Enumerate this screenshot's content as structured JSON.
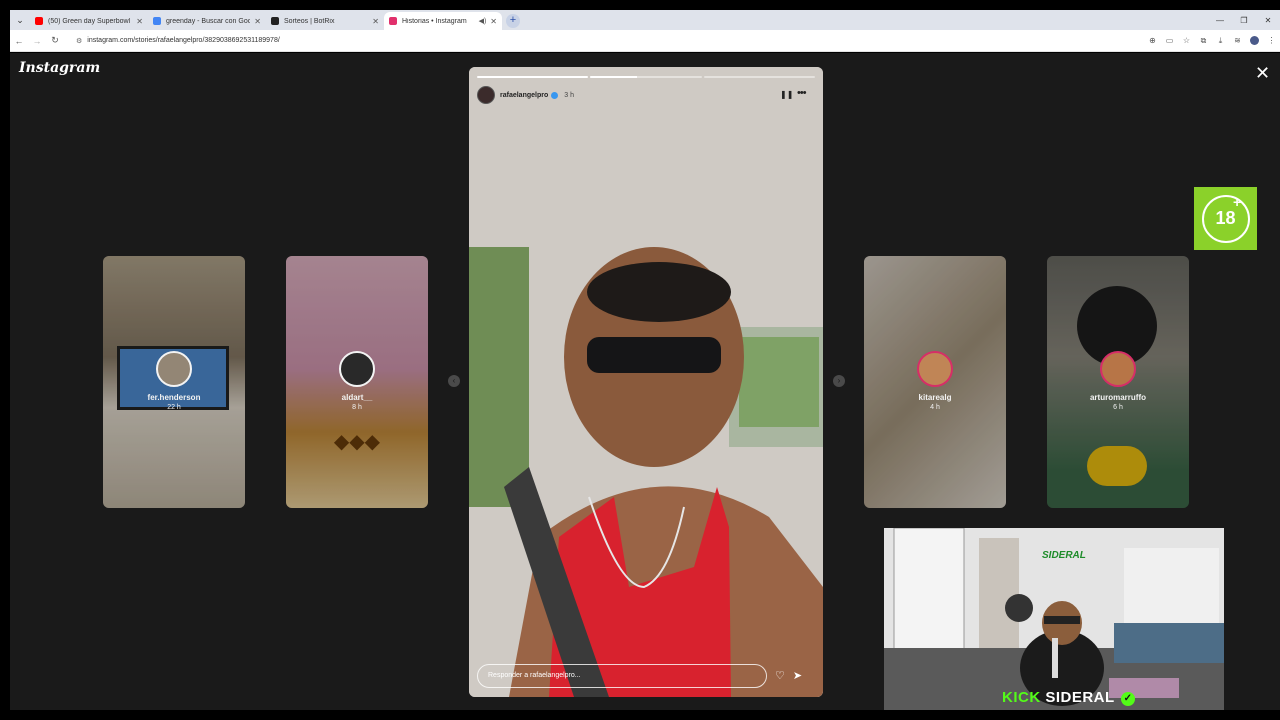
{
  "browser": {
    "tabs": [
      {
        "title": "(50) Green day Superbowl 202...",
        "favicon_color": "#ff0000",
        "icon": "youtube-icon"
      },
      {
        "title": "greenday - Buscar con Google",
        "favicon_color": "#4285f4",
        "icon": "google-icon"
      },
      {
        "title": "Sorteos | BotRix",
        "favicon_color": "#222222",
        "icon": "botrix-icon"
      },
      {
        "title": "Historias • Instagram",
        "favicon_color": "#e1306c",
        "icon": "instagram-icon",
        "active": true
      }
    ],
    "url": "instagram.com/stories/rafaelangelpro/3829038692531189978/"
  },
  "instagram": {
    "logo": "Instagram",
    "side_stories_left": [
      {
        "username": "fer.henderson",
        "time": "22 h",
        "bg": "#8a7b66"
      },
      {
        "username": "aldart__",
        "time": "8 h",
        "bg": "#d9a6b8"
      }
    ],
    "side_stories_right": [
      {
        "username": "kitarealg",
        "time": "4 h",
        "bg": "#b9a894"
      },
      {
        "username": "arturomarruffo",
        "time": "6 h",
        "bg": "#7a8a6c"
      }
    ],
    "main_story": {
      "username": "rafaelangelpro",
      "time": "3 h",
      "reply_placeholder": "Responder a rafaelangelpro...",
      "segments": [
        1.0,
        0.42,
        0
      ]
    }
  },
  "overlay": {
    "age_badge": "18",
    "stream_brand_kick": "KICK",
    "stream_brand_name": "SIDERAL",
    "cam_sign": "SIDERAL"
  },
  "colors": {
    "kick_green": "#53fc18",
    "age_green": "#8bd12a"
  }
}
